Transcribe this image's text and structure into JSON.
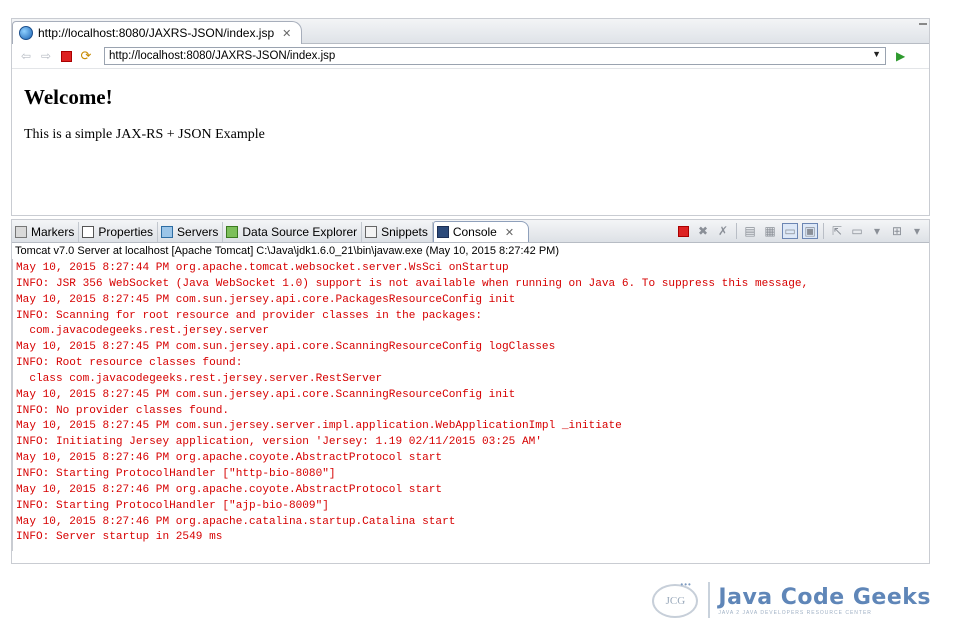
{
  "browser": {
    "tab_title": "http://localhost:8080/JAXRS-JSON/index.jsp",
    "url": "http://localhost:8080/JAXRS-JSON/index.jsp",
    "page": {
      "heading": "Welcome!",
      "text": "This is a simple JAX-RS + JSON Example"
    }
  },
  "views": {
    "tabs": [
      {
        "label": "Markers",
        "icon": "markers-icon"
      },
      {
        "label": "Properties",
        "icon": "properties-icon"
      },
      {
        "label": "Servers",
        "icon": "servers-icon"
      },
      {
        "label": "Data Source Explorer",
        "icon": "data-source-icon"
      },
      {
        "label": "Snippets",
        "icon": "snippets-icon"
      },
      {
        "label": "Console",
        "icon": "console-icon",
        "active": true
      }
    ]
  },
  "console": {
    "process_label": "Tomcat v7.0 Server at localhost [Apache Tomcat] C:\\Java\\jdk1.6.0_21\\bin\\javaw.exe (May 10, 2015 8:27:42 PM)",
    "text_color": "#d60000",
    "lines": [
      "May 10, 2015 8:27:44 PM org.apache.tomcat.websocket.server.WsSci onStartup",
      "INFO: JSR 356 WebSocket (Java WebSocket 1.0) support is not available when running on Java 6. To suppress this message,",
      "May 10, 2015 8:27:45 PM com.sun.jersey.api.core.PackagesResourceConfig init",
      "INFO: Scanning for root resource and provider classes in the packages:",
      "  com.javacodegeeks.rest.jersey.server",
      "May 10, 2015 8:27:45 PM com.sun.jersey.api.core.ScanningResourceConfig logClasses",
      "INFO: Root resource classes found:",
      "  class com.javacodegeeks.rest.jersey.server.RestServer",
      "May 10, 2015 8:27:45 PM com.sun.jersey.api.core.ScanningResourceConfig init",
      "INFO: No provider classes found.",
      "May 10, 2015 8:27:45 PM com.sun.jersey.server.impl.application.WebApplicationImpl _initiate",
      "INFO: Initiating Jersey application, version 'Jersey: 1.19 02/11/2015 03:25 AM'",
      "May 10, 2015 8:27:46 PM org.apache.coyote.AbstractProtocol start",
      "INFO: Starting ProtocolHandler [\"http-bio-8080\"]",
      "May 10, 2015 8:27:46 PM org.apache.coyote.AbstractProtocol start",
      "INFO: Starting ProtocolHandler [\"ajp-bio-8009\"]",
      "May 10, 2015 8:27:46 PM org.apache.catalina.startup.Catalina start",
      "INFO: Server startup in 2549 ms"
    ]
  },
  "watermark": {
    "logo_text": "JCG",
    "brand": "Java Code Geeks",
    "tagline": "JAVA 2 JAVA DEVELOPERS RESOURCE CENTER"
  }
}
